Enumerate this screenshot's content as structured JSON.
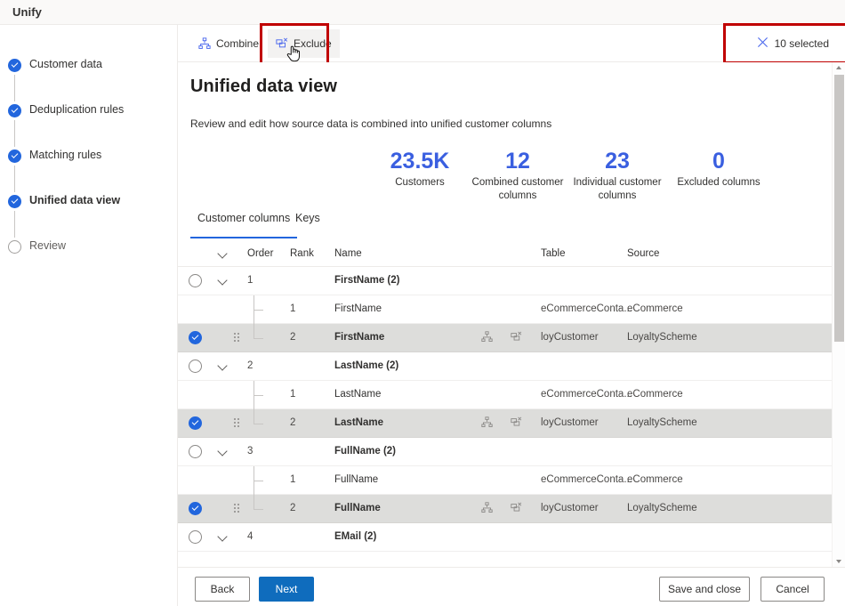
{
  "app": {
    "title": "Unify"
  },
  "wizard": {
    "steps": [
      {
        "label": "Customer data",
        "state": "done"
      },
      {
        "label": "Deduplication rules",
        "state": "done"
      },
      {
        "label": "Matching rules",
        "state": "done"
      },
      {
        "label": "Unified data view",
        "state": "current"
      },
      {
        "label": "Review",
        "state": "todo"
      }
    ]
  },
  "commandbar": {
    "combine_label": "Combine",
    "exclude_label": "Exclude",
    "selection_label": "10 selected",
    "focused_command": "Exclude"
  },
  "page": {
    "title": "Unified data view",
    "subtitle": "Review and edit how source data is combined into unified customer columns"
  },
  "stats": [
    {
      "value": "23.5K",
      "caption": "Customers"
    },
    {
      "value": "12",
      "caption": "Combined customer columns"
    },
    {
      "value": "23",
      "caption": "Individual customer columns"
    },
    {
      "value": "0",
      "caption": "Excluded columns"
    }
  ],
  "tabs": [
    {
      "label": "Customer columns",
      "active": true
    },
    {
      "label": "Keys",
      "active": false
    }
  ],
  "grid": {
    "columns": [
      "Order",
      "Rank",
      "Name",
      "Table",
      "Source"
    ],
    "rows": [
      {
        "type": "group",
        "checked": false,
        "order": "1",
        "rank": "",
        "name": "FirstName (2)",
        "table": "",
        "source": "",
        "selected": false
      },
      {
        "type": "child",
        "checked": false,
        "order": "",
        "rank": "1",
        "name": "FirstName",
        "table": "eCommerceConta...",
        "source": "eCommerce",
        "selected": false
      },
      {
        "type": "child",
        "checked": true,
        "order": "",
        "rank": "2",
        "name": "FirstName",
        "table": "loyCustomer",
        "source": "LoyaltyScheme",
        "selected": true
      },
      {
        "type": "group",
        "checked": false,
        "order": "2",
        "rank": "",
        "name": "LastName (2)",
        "table": "",
        "source": "",
        "selected": false
      },
      {
        "type": "child",
        "checked": false,
        "order": "",
        "rank": "1",
        "name": "LastName",
        "table": "eCommerceConta...",
        "source": "eCommerce",
        "selected": false
      },
      {
        "type": "child",
        "checked": true,
        "order": "",
        "rank": "2",
        "name": "LastName",
        "table": "loyCustomer",
        "source": "LoyaltyScheme",
        "selected": true
      },
      {
        "type": "group",
        "checked": false,
        "order": "3",
        "rank": "",
        "name": "FullName (2)",
        "table": "",
        "source": "",
        "selected": false
      },
      {
        "type": "child",
        "checked": false,
        "order": "",
        "rank": "1",
        "name": "FullName",
        "table": "eCommerceConta...",
        "source": "eCommerce",
        "selected": false
      },
      {
        "type": "child",
        "checked": true,
        "order": "",
        "rank": "2",
        "name": "FullName",
        "table": "loyCustomer",
        "source": "LoyaltyScheme",
        "selected": true
      },
      {
        "type": "group",
        "checked": false,
        "order": "4",
        "rank": "",
        "name": "EMail (2)",
        "table": "",
        "source": "",
        "selected": false
      }
    ]
  },
  "footer": {
    "back_label": "Back",
    "next_label": "Next",
    "save_label": "Save and close",
    "cancel_label": "Cancel"
  },
  "colors": {
    "accent": "#2266dd",
    "primary_button": "#0f6cbd",
    "stat_number": "#3a5fe0",
    "focus_outline": "#c00000",
    "selected_row": "#dddddb"
  }
}
